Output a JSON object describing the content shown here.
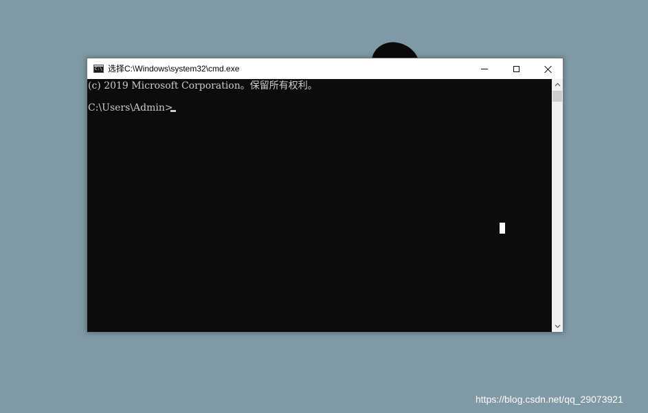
{
  "window": {
    "title": "选择C:\\Windows\\system32\\cmd.exe",
    "icon_label": "C:\\"
  },
  "console": {
    "lines": [
      "(c) 2019 Microsoft Corporation。保留所有权利。",
      "C:\\Users\\Admin>"
    ],
    "background_color": "#0c0c0c",
    "text_color": "#cccccc"
  },
  "icons": {
    "minimize": "minimize-icon",
    "maximize": "maximize-icon",
    "close": "close-icon",
    "scroll_up": "chevron-up-icon",
    "scroll_down": "chevron-down-icon"
  },
  "watermark": {
    "text": "https://blog.csdn.net/qq_29073921"
  },
  "desktop": {
    "background_color": "#7f99a6"
  }
}
